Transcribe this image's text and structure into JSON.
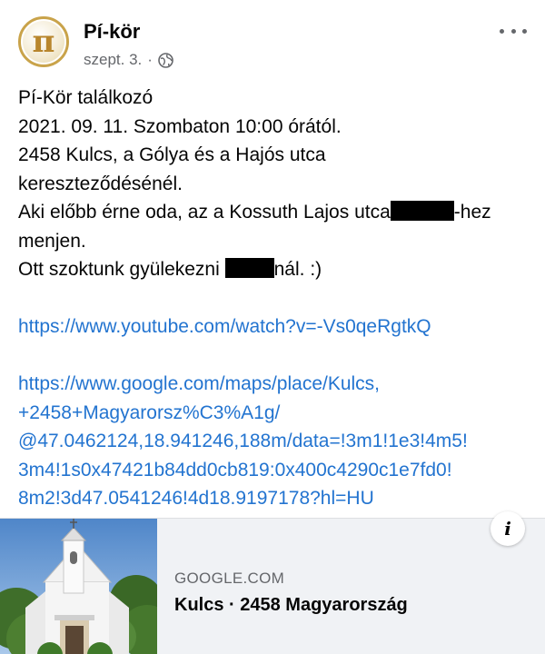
{
  "post": {
    "author": "Pí-kör",
    "avatar_symbol": "π",
    "date": "szept. 3.",
    "separator": "·",
    "privacy_icon": "globe-icon",
    "more_icon": "more-horizontal-icon"
  },
  "content": {
    "line1": "Pí-Kör találkozó",
    "line2": "2021. 09. 11. Szombaton 10:00 órától.",
    "line3": "2458 Kulcs, a Gólya és a Hajós utca",
    "line4": "kereszteződésénél.",
    "line5_before": "Aki előbb érne oda, az a Kossuth Lajos utca",
    "line5_after": "-hez",
    "line6": "menjen.",
    "line7_before": "Ott szoktunk gyülekezni",
    "line7_after": "nál. :)",
    "link_youtube": "https://www.youtube.com/watch?v=-Vs0qeRgtkQ",
    "link_maps_lines": [
      "https://www.google.com/maps/place/Kulcs,",
      "+2458+Magyarorsz%C3%A1g/",
      "@47.0462124,18.941246,188m/data=!3m1!1e3!4m5!",
      "3m4!1s0x47421b84dd0cb819:0x400c4290c1e7fd0!",
      "8m2!3d47.0541246!4d18.9197178?hl=HU"
    ]
  },
  "link_preview": {
    "domain": "GOOGLE.COM",
    "title": "Kulcs · 2458 Magyarország",
    "info_icon": "info-icon",
    "info_label": "i"
  },
  "colors": {
    "link": "#2374d0",
    "muted": "#65676b",
    "avatar_gold": "#c9a34a"
  }
}
